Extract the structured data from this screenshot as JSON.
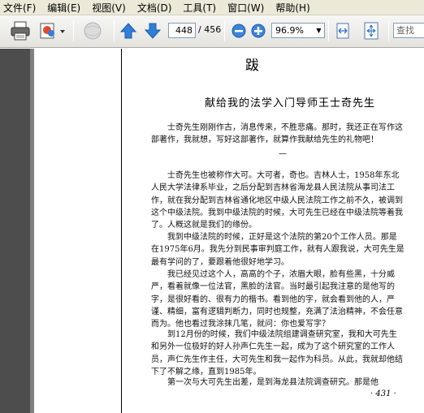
{
  "menu": {
    "file": "文件(F)",
    "edit": "编辑(E)",
    "view": "视图(V)",
    "document": "文档(D)",
    "tools": "工具(T)",
    "window": "窗口(W)",
    "help": "帮助(H)"
  },
  "toolbar": {
    "current_page": "448",
    "total_pages": "/ 456",
    "zoom": "96.9%",
    "search_placeholder": "查找",
    "icons": [
      "print-icon",
      "export-icon",
      "web-icon",
      "previous-page-icon",
      "next-page-icon",
      "zoom-out-icon",
      "zoom-in-icon",
      "fit-width-icon",
      "fit-page-icon"
    ]
  },
  "document": {
    "page_title": "跋",
    "subtitle": "献给我的法学入门导师王士奇先生",
    "intro": "士奇先生刚刚作古，消息传来，不胜悲痛。那时，我还正在写作这部著作，我就想，写好这部著作，就算作我献给先生的礼物吧！",
    "divider": "—",
    "paragraphs": [
      "士奇先生也被称作大可。大可者，奇也。吉林人士，1958年东北人民大学法律系毕业，之后分配到吉林省海龙县人民法院从事司法工作，就在我分配到吉林省通化地区中级人民法院工作之前不久，被调到这个中级法院。我到中级法院的时候，大可先生已经在中级法院等着我了。人概这就是我们的缘份。",
      "我到中级法院的时候，正好是这个法院的第20个工作人员。那是在1975年6月。我先分到民事审判庭工作，就有人跟我说，大可先生是最有学问的了，要跟着他很好地学习。",
      "我已经见过这个人，高高的个子，浓眉大眼，脸有些黑，十分威严，看着就像一位法官，黑脸的法官。当时最引起我注意的是他写的字，是很好看的、很有力的楷书。看到他的字，就会看到他的人，严谨、精细，富有逻辑判断力，同时也规整，充满了法治精神，不会任意而为。他也看过我涂抹几笔，就问：你也爱写字？",
      "到12月份的时候，我们中级法院组建调查研究室，我和大可先生和另外一位极好的好人孙声仁先生一起，成为了这个研究室的工作人员，声仁先生作主任，大可先生和我一起作为科员。从此，我就却他结下了不解之缘，直到1985年。",
      "第一次与大可先生出差，是到海龙县法院调查研究。那是他"
    ],
    "page_number": "· 431 ·"
  }
}
